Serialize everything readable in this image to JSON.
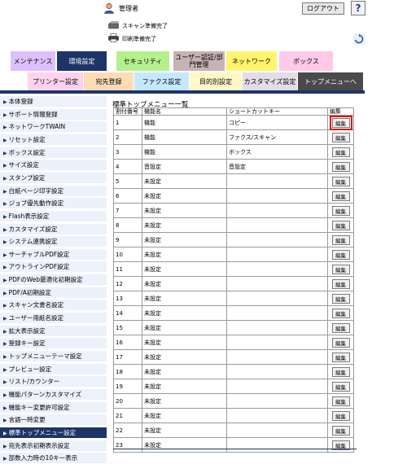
{
  "header": {
    "user_label": "管理者",
    "logout_label": "ログアウト",
    "help_label": "?",
    "scan_status": "スキャン準備完了",
    "print_status": "印刷準備完了"
  },
  "tabs_row1": [
    {
      "label": "メンテナンス",
      "bg": "#dcc0ff",
      "fg": "#000000"
    },
    {
      "label": "環境設定",
      "bg": "#1d3468",
      "fg": "#ffffff"
    },
    {
      "label": "セキュリティ",
      "bg": "#b4f08e",
      "fg": "#000000"
    },
    {
      "label": "ユーザー認証/部門管理",
      "bg": "#c7b3b3",
      "fg": "#000000"
    },
    {
      "label": "ネットワーク",
      "bg": "#fff46e",
      "fg": "#000000"
    },
    {
      "label": "ボックス",
      "bg": "#ffc9e8",
      "fg": "#000000"
    }
  ],
  "tabs_row2": [
    {
      "label": "プリンター設定",
      "bg": "#ffd2ee",
      "fg": "#000000"
    },
    {
      "label": "宛先登録",
      "bg": "#ffdcb6",
      "fg": "#000000"
    },
    {
      "label": "ファクス設定",
      "bg": "#c6e8ff",
      "fg": "#000000"
    },
    {
      "label": "目的別設定",
      "bg": "#fff7c6",
      "fg": "#000000"
    },
    {
      "label": "カスタマイズ設定",
      "bg": "#e2dde6",
      "fg": "#000000"
    },
    {
      "label": "トップメニューへ",
      "bg": "#4a4a4a",
      "fg": "#ffffff"
    }
  ],
  "sidebar": {
    "items": [
      "本体登録",
      "サポート情報登録",
      "ネットワークTWAIN",
      "リセット設定",
      "ボックス設定",
      "サイズ設定",
      "スタンプ設定",
      "白紙ページ印字設定",
      "ジョブ優先動作設定",
      "Flash表示設定",
      "カスタマイズ設定",
      "システム連携設定",
      "サーチャブルPDF設定",
      "アウトラインPDF設定",
      "PDFのWeb最適化初期設定",
      "PDF/A初期設定",
      "スキャン文書名設定",
      "ユーザー用紙名設定",
      "拡大表示設定",
      "登録キー設定",
      "トップメニューテーマ設定",
      "プレビュー設定",
      "リスト/カウンター",
      "機能パターンカスタマイズ",
      "機能キー変更許可設定",
      "言語一時変更",
      "標準トップメニュー設定",
      "宛先表示初期表示設定",
      "部数入力時の10キー表示"
    ],
    "active_index": 26
  },
  "main": {
    "title": "標準トップメニュー一覧",
    "columns": [
      "割付番号",
      "機能名",
      "ショートカットキー",
      "編集"
    ],
    "edit_label": "編集",
    "selected_row": 0,
    "rows": [
      {
        "no": "1",
        "func": "機能",
        "key": "コピー"
      },
      {
        "no": "2",
        "func": "機能",
        "key": "ファクス/スキャン"
      },
      {
        "no": "3",
        "func": "機能",
        "key": "ボックス"
      },
      {
        "no": "4",
        "func": "音設定",
        "key": "音設定"
      },
      {
        "no": "5",
        "func": "未設定",
        "key": ""
      },
      {
        "no": "6",
        "func": "未設定",
        "key": ""
      },
      {
        "no": "7",
        "func": "未設定",
        "key": ""
      },
      {
        "no": "8",
        "func": "未設定",
        "key": ""
      },
      {
        "no": "9",
        "func": "未設定",
        "key": ""
      },
      {
        "no": "10",
        "func": "未設定",
        "key": ""
      },
      {
        "no": "11",
        "func": "未設定",
        "key": ""
      },
      {
        "no": "12",
        "func": "未設定",
        "key": ""
      },
      {
        "no": "13",
        "func": "未設定",
        "key": ""
      },
      {
        "no": "14",
        "func": "未設定",
        "key": ""
      },
      {
        "no": "15",
        "func": "未設定",
        "key": ""
      },
      {
        "no": "16",
        "func": "未設定",
        "key": ""
      },
      {
        "no": "17",
        "func": "未設定",
        "key": ""
      },
      {
        "no": "18",
        "func": "未設定",
        "key": ""
      },
      {
        "no": "19",
        "func": "未設定",
        "key": ""
      },
      {
        "no": "20",
        "func": "未設定",
        "key": ""
      },
      {
        "no": "21",
        "func": "未設定",
        "key": ""
      },
      {
        "no": "22",
        "func": "未設定",
        "key": ""
      },
      {
        "no": "23",
        "func": "未設定",
        "key": ""
      }
    ]
  },
  "colors": {
    "accent": "#1d3468",
    "sidebar_bg": "#ecf1fa",
    "selected_outline": "#e01010"
  }
}
